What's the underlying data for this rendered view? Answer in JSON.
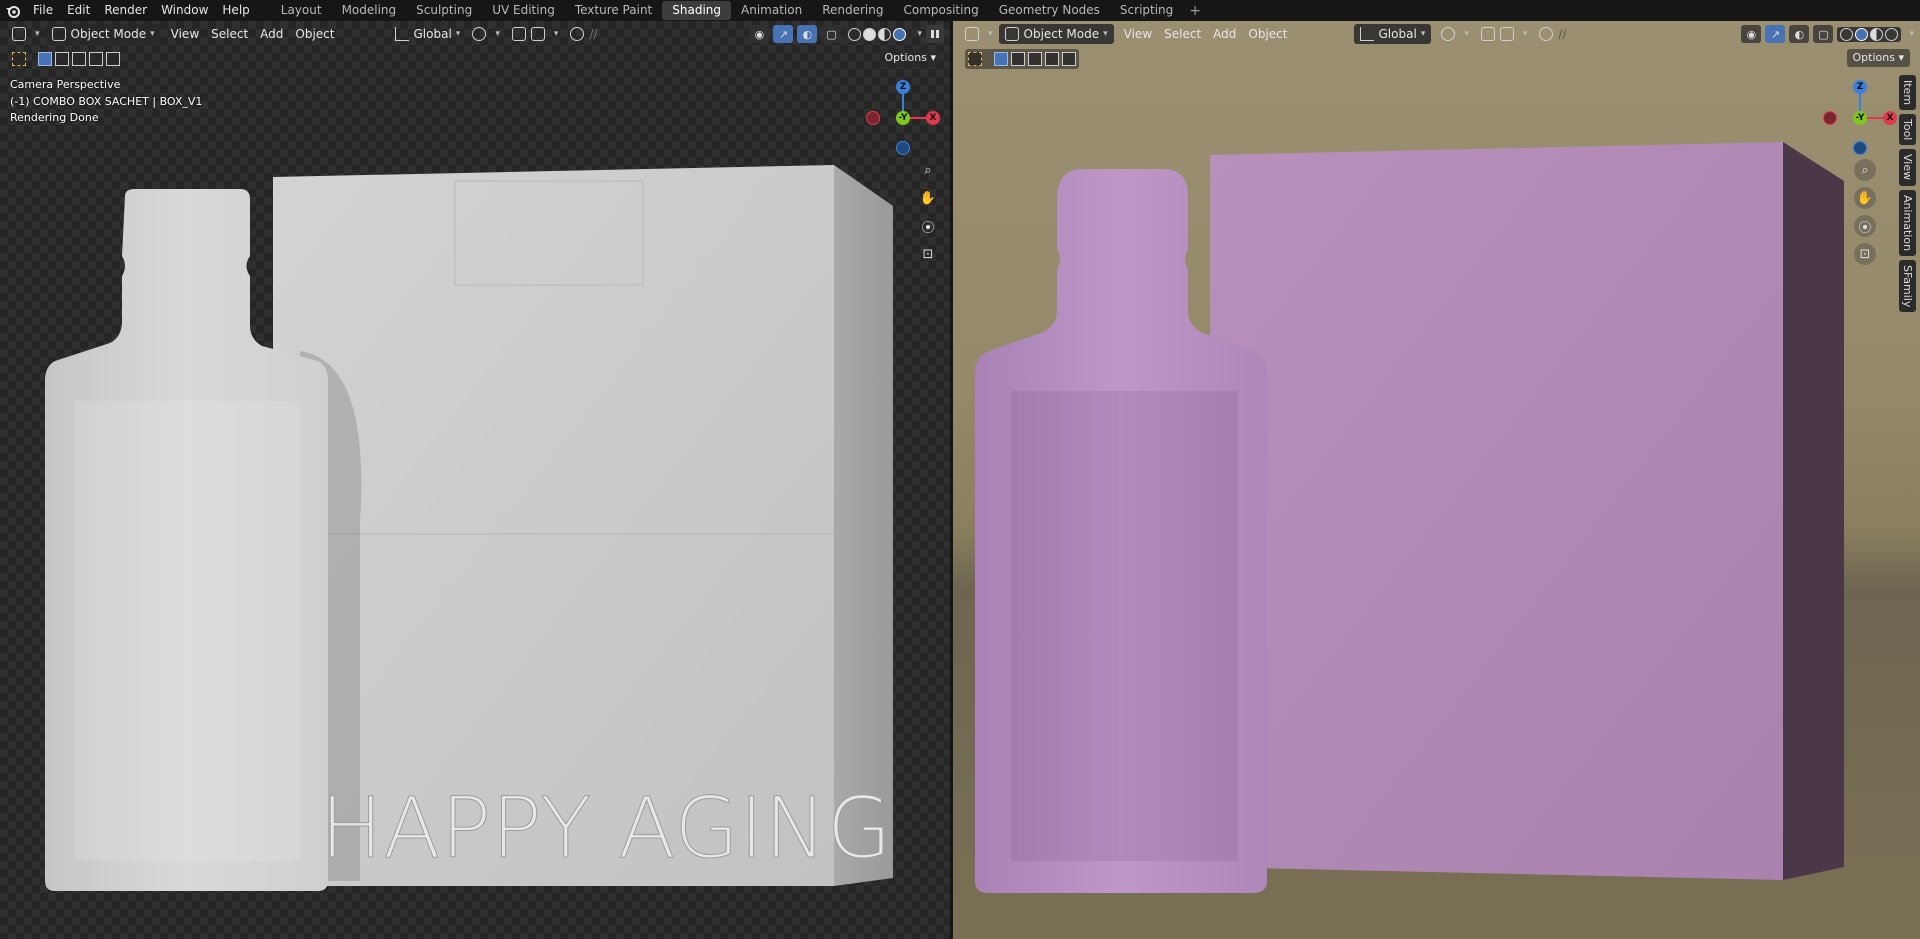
{
  "menu": {
    "items": [
      "File",
      "Edit",
      "Render",
      "Window",
      "Help"
    ]
  },
  "workspaces": {
    "tabs": [
      "Layout",
      "Modeling",
      "Sculpting",
      "UV Editing",
      "Texture Paint",
      "Shading",
      "Animation",
      "Rendering",
      "Compositing",
      "Geometry Nodes",
      "Scripting"
    ],
    "active": "Shading",
    "add": "+"
  },
  "left": {
    "mode": "Object Mode",
    "menus": [
      "View",
      "Select",
      "Add",
      "Object"
    ],
    "orientation": "Global",
    "options": "Options",
    "overlay": {
      "camera": "Camera Perspective",
      "object": "(-1) COMBO BOX SACHET | BOX_V1",
      "status": "Rendering Done"
    },
    "box_text": "HAPPY AGING"
  },
  "right": {
    "mode": "Object Mode",
    "menus": [
      "View",
      "Select",
      "Add",
      "Object"
    ],
    "orientation": "Global",
    "options": "Options",
    "side_tabs": [
      "Item",
      "Tool",
      "View",
      "Animation",
      "SFamily"
    ]
  },
  "gizmo": {
    "z": "Z",
    "y": "-Y",
    "x": "X"
  },
  "colors": {
    "x": "#e0394d",
    "y": "#7ec71c",
    "z": "#3a7fd8",
    "accent": "#4772b3",
    "sachet_pink": "#b48fbf",
    "box_pink": "#b48cb6"
  }
}
